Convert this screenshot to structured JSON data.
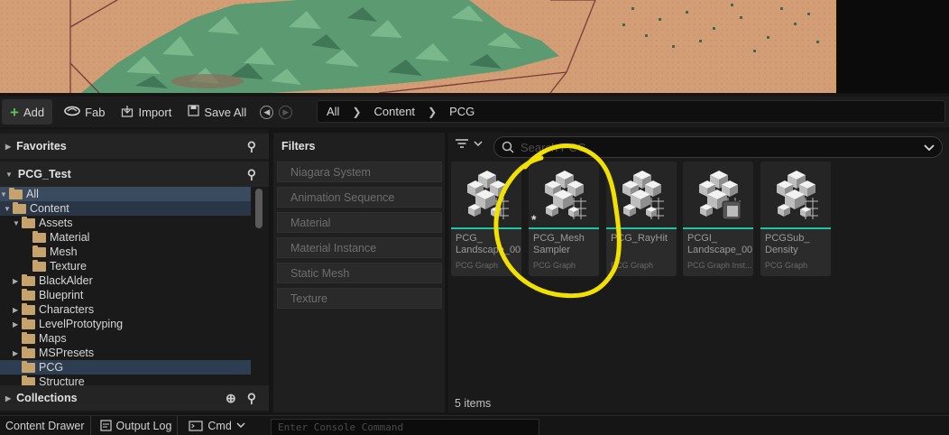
{
  "toolbar": {
    "add_label": "Add",
    "fab_label": "Fab",
    "import_label": "Import",
    "save_all_label": "Save All"
  },
  "breadcrumb": [
    "All",
    "Content",
    "PCG"
  ],
  "favorites": {
    "label": "Favorites"
  },
  "project": {
    "label": "PCG_Test"
  },
  "tree": [
    {
      "label": "All",
      "depth": 0,
      "expanded": true
    },
    {
      "label": "Content",
      "depth": 1,
      "expanded": true
    },
    {
      "label": "Assets",
      "depth": 2,
      "expanded": true
    },
    {
      "label": "Material",
      "depth": 3
    },
    {
      "label": "Mesh",
      "depth": 3
    },
    {
      "label": "Texture",
      "depth": 3
    },
    {
      "label": "BlackAlder",
      "depth": 2,
      "collapsed": true
    },
    {
      "label": "Blueprint",
      "depth": 2
    },
    {
      "label": "Characters",
      "depth": 2,
      "collapsed": true
    },
    {
      "label": "LevelPrototyping",
      "depth": 2,
      "collapsed": true
    },
    {
      "label": "Maps",
      "depth": 2
    },
    {
      "label": "MSPresets",
      "depth": 2,
      "collapsed": true
    },
    {
      "label": "PCG",
      "depth": 2,
      "selected": true
    },
    {
      "label": "Structure",
      "depth": 2
    }
  ],
  "collections": {
    "label": "Collections"
  },
  "filters": {
    "title": "Filters",
    "items": [
      "Niagara System",
      "Animation Sequence",
      "Material",
      "Material Instance",
      "Static Mesh",
      "Texture"
    ]
  },
  "search": {
    "placeholder": "Search PCG"
  },
  "assets": [
    {
      "name": "PCG_\nLandscape_00",
      "type": "PCG Graph"
    },
    {
      "name": "PCG_Mesh\nSampler",
      "type": "PCG Graph"
    },
    {
      "name": "PCG_RayHit",
      "type": "PCG Graph"
    },
    {
      "name": "PCGI_\nLandscape_00",
      "type": "PCG Graph Inst..."
    },
    {
      "name": "PCGSub_\nDensity",
      "type": "PCG Graph"
    }
  ],
  "item_count": "5 items",
  "bottom": {
    "content_drawer": "Content Drawer",
    "output_log": "Output Log",
    "cmd": "Cmd",
    "console_placeholder": "Enter Console Command"
  },
  "colors": {
    "accent_teal": "#23c2a4",
    "folder": "#c6a26d",
    "viewport_border": "#e5a31b",
    "annotation": "#f2e100"
  }
}
